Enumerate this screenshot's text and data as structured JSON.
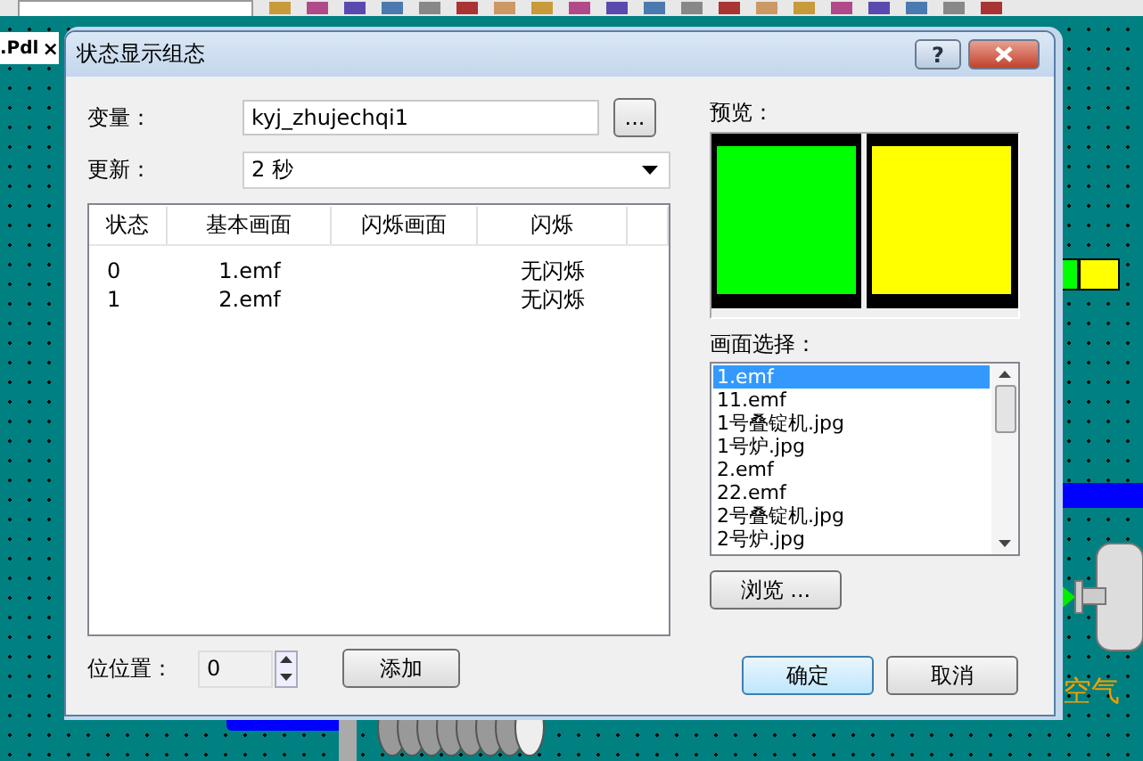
{
  "background": {
    "tab": {
      "label": ".Pdl",
      "close": "×"
    },
    "canvas_label": "空气"
  },
  "dialog": {
    "title": "状态显示组态",
    "help": "?",
    "variable": {
      "label": "变量：",
      "value": "kyj_zhujechqi1",
      "browse": "..."
    },
    "update": {
      "label": "更新：",
      "value": "2 秒"
    },
    "table": {
      "columns": [
        "状态",
        "基本画面",
        "闪烁画面",
        "闪烁"
      ],
      "rows": [
        {
          "state": "0",
          "image": "1.emf",
          "blink": "无闪烁"
        },
        {
          "state": "1",
          "image": "2.emf",
          "blink": "无闪烁"
        }
      ]
    },
    "preview": {
      "label": "预览："
    },
    "picture_select": {
      "label": "画面选择：",
      "items": [
        {
          "label": "1.emf",
          "selected": true
        },
        {
          "label": "11.emf",
          "selected": false
        },
        {
          "label": "1号叠锭机.jpg",
          "selected": false
        },
        {
          "label": "1号炉.jpg",
          "selected": false
        },
        {
          "label": "2.emf",
          "selected": false
        },
        {
          "label": "22.emf",
          "selected": false
        },
        {
          "label": "2号叠锭机.jpg",
          "selected": false
        },
        {
          "label": "2号炉.jpg",
          "selected": false
        }
      ]
    },
    "browse_button": "浏览 ...",
    "bit_position": {
      "label": "位位置：",
      "value": "0"
    },
    "add_button": "添加",
    "ok_button": "确定",
    "cancel_button": "取消"
  }
}
